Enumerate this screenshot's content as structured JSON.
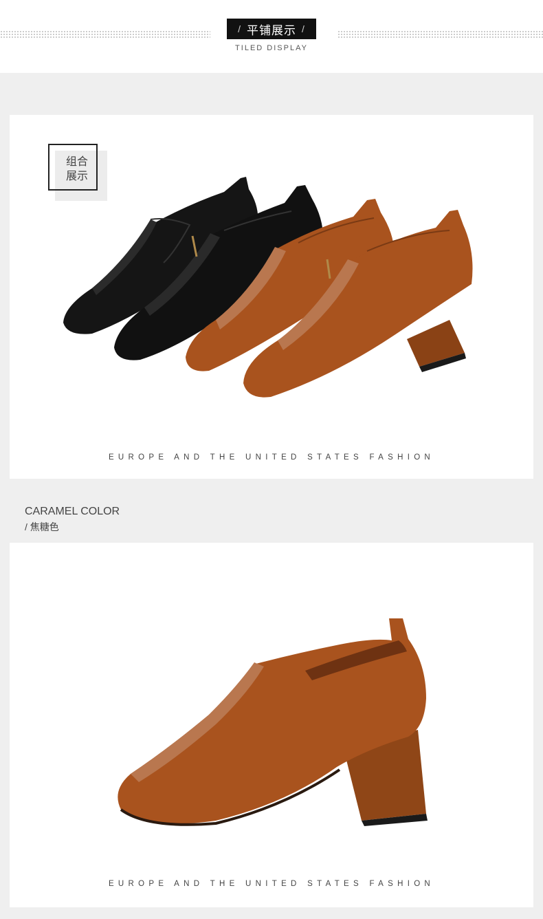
{
  "header": {
    "title": "平铺展示",
    "slash_left": "/",
    "slash_right": "/",
    "subtitle": "TILED DISPLAY"
  },
  "panel1": {
    "combo_label": "组合展示",
    "tagline": "EUROPE AND THE UNITED STATES FASHION"
  },
  "color_section": {
    "label": "CARAMEL COLOR",
    "sublabel": "/ 焦糖色"
  },
  "panel2": {
    "tagline": "EUROPE AND THE UNITED STATES FASHION"
  },
  "colors": {
    "caramel": "#a9531e",
    "caramel_dark": "#7a3a14",
    "leather_trim": "#b9774f",
    "black_suede": "#1a1a1a",
    "background": "#efefef"
  },
  "images": [
    {
      "name": "black-shoe-pair",
      "color": "black"
    },
    {
      "name": "caramel-shoe-pair",
      "color": "caramel"
    },
    {
      "name": "caramel-shoe-single",
      "color": "caramel"
    }
  ]
}
